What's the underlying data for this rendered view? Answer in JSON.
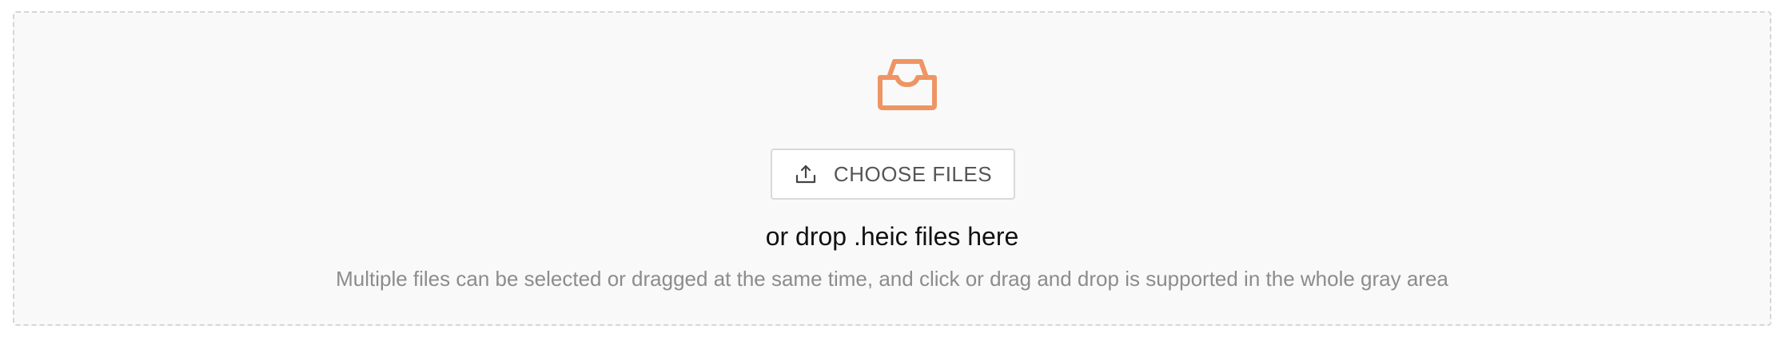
{
  "dropzone": {
    "icon": "inbox-icon",
    "accent_color": "#ee9564",
    "choose_button": {
      "icon": "upload-icon",
      "label": "CHOOSE FILES"
    },
    "drop_text": "or drop .heic files here",
    "hint_text": "Multiple files can be selected or dragged at the same time, and click or drag and drop is supported in the whole gray area"
  }
}
